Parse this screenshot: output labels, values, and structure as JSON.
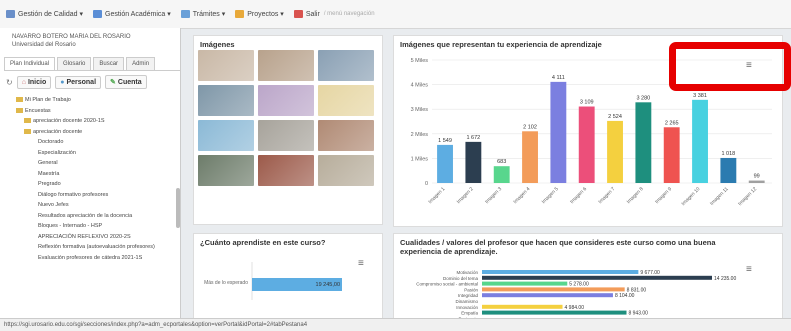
{
  "menu": [
    {
      "label": "Gestión de Calidad ▾",
      "color": "#6a8fc9"
    },
    {
      "label": "Gestión Académica ▾",
      "color": "#5b8ed6"
    },
    {
      "label": "Trámites ▾",
      "color": "#6aa0d8"
    },
    {
      "label": "Proyectos ▾",
      "color": "#e8a93a"
    },
    {
      "label": "Salir",
      "color": "#d9534f"
    }
  ],
  "menu_extra": "/ menú navegación",
  "user": {
    "name": "NAVARRO BOTERO MARIA DEL ROSARIO",
    "org": "Universidad del Rosario"
  },
  "tabs": [
    "Plan Individual",
    "Glosario",
    "Buscar",
    "Admin"
  ],
  "subtabs": [
    "Inicio",
    "Personal",
    "Cuenta"
  ],
  "tree": [
    {
      "label": "Mi Plan de Trabajo",
      "level": 1,
      "folder": true
    },
    {
      "label": "Encuestas",
      "level": 1,
      "folder": true
    },
    {
      "label": "apreciación docente 2020-1S",
      "level": 2,
      "folder": true
    },
    {
      "label": "apreciación docente",
      "level": 2,
      "folder": true
    },
    {
      "label": "Doctorado",
      "level": 3
    },
    {
      "label": "Especialización",
      "level": 3
    },
    {
      "label": "General",
      "level": 3
    },
    {
      "label": "Maestría",
      "level": 3
    },
    {
      "label": "Pregrado",
      "level": 3
    },
    {
      "label": "Diálogo formativo profesores",
      "level": 3
    },
    {
      "label": "Nuevo Jefes",
      "level": 3
    },
    {
      "label": "Resultados apreciación de la docencia",
      "level": 3
    },
    {
      "label": "Bloques - Internado - HSP",
      "level": 3
    },
    {
      "label": "APRECIACIÓN REFLEXIVO 2020-2S",
      "level": 3
    },
    {
      "label": "Reflexión formativa (autoevaluación profesores)",
      "level": 3
    },
    {
      "label": "Evaluación profesores de cátedra 2021-1S",
      "level": 3
    }
  ],
  "images_panel": {
    "title": "Imágenes"
  },
  "thumb_colors": [
    "#c9b8a6",
    "#b8a28c",
    "#8aa0b4",
    "#7f97a8",
    "#bba6c9",
    "#e6d6a3",
    "#8bb9d6",
    "#a7a39b",
    "#b08a74",
    "#6d7c6a",
    "#9c5a4a",
    "#b7ad9b"
  ],
  "experience_panel": {
    "title": "Imágenes que representan tu experiencia de aprendizaje"
  },
  "learn_panel": {
    "title": "¿Cuánto aprendiste en este curso?"
  },
  "qual_panel": {
    "title": "Cualidades / valores del profesor que hacen que consideres este curso como una buena experiencia de aprendizaje."
  },
  "status_url": "https://sgi.urosario.edu.co/sgi/secciones/index.php?a=adm_ecportales&option=verPortal&idPortal=2#tabPestana4",
  "chart_data": [
    {
      "type": "bar",
      "title": "Imágenes que representan tu experiencia de aprendizaje",
      "categories": [
        "Imagen 1",
        "Imagen 2",
        "Imagen 3",
        "Imagen 4",
        "Imagen 5",
        "Imagen 6",
        "Imagen 7",
        "Imagen 8",
        "Imagen 9",
        "Imagen 10",
        "Imagen 11",
        "Imagen 12"
      ],
      "values": [
        1549,
        1672,
        683,
        2102,
        4111,
        3109,
        2524,
        3280,
        2265,
        3381,
        1018,
        99
      ],
      "labels": [
        "1 549",
        "1 672",
        "683",
        "2 102",
        "4 111",
        "3 109",
        "2 524",
        "3 280",
        "2 265",
        "3 381",
        "1 018",
        "99"
      ],
      "colors": [
        "#5dade2",
        "#2c3e50",
        "#58d68d",
        "#f39c5a",
        "#7b7fe0",
        "#ec4f7a",
        "#f4d03f",
        "#1e8f7e",
        "#ef5350",
        "#48d1e0",
        "#2b7bb0",
        "#a0a0a0"
      ],
      "yticks": [
        "0",
        "1 Miles",
        "2 Miles",
        "3 Miles",
        "4 Miles",
        "5 Miles"
      ],
      "ylim": [
        0,
        5000
      ]
    },
    {
      "type": "bar",
      "title": "¿Cuánto aprendiste en este curso?",
      "categories": [
        "Más de lo esperado"
      ],
      "values": [
        19245
      ],
      "labels": [
        "19 245,00"
      ],
      "colors": [
        "#5dade2"
      ]
    },
    {
      "type": "bar",
      "title": "Cualidades / valores del profesor que hacen que consideres este curso como una buena experiencia de aprendizaje.",
      "categories": [
        "Motivación",
        "Dominio del tema",
        "Compromiso social - ambiental",
        "Pasión",
        "Integridad",
        "Dinamismo",
        "Innovación",
        "Empatía",
        "Paciencia"
      ],
      "values": [
        9677,
        14235,
        5278,
        8831,
        8104,
        null,
        4984,
        8943,
        null
      ],
      "labels": [
        "9 677.00",
        "14 235.00",
        "5 278.00",
        "8 831.00",
        "8 104.00",
        "",
        "4 984.00",
        "8 943.00",
        ""
      ],
      "colors": [
        "#5dade2",
        "#2c3e50",
        "#58d68d",
        "#f39c5a",
        "#7b7fe0",
        "#ec4f7a",
        "#f4d03f",
        "#1e8f7e",
        "#ef5350"
      ]
    }
  ]
}
